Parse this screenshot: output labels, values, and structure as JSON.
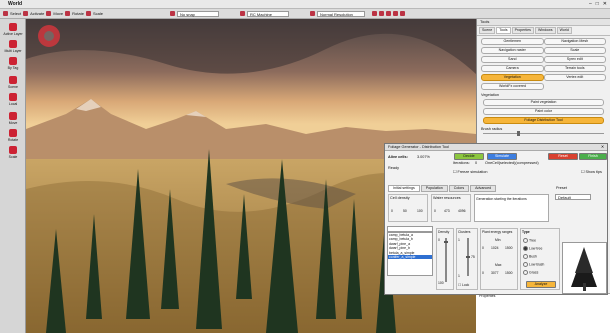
{
  "window": {
    "title": "World",
    "controls": [
      "–",
      "□",
      "✕"
    ]
  },
  "toolbar": {
    "items": [
      "Select",
      "Activate",
      "Move",
      "Rotate",
      "Scale"
    ],
    "dropdown1": "No snap",
    "dropdown2": "RC Machine",
    "dropdown3": "Normal Resolution",
    "icon_color": "#b33344"
  },
  "left_tools": [
    {
      "label": "Active Layer"
    },
    {
      "label": "Multi Layer"
    },
    {
      "label": "By Tag"
    },
    {
      "label": "Scene"
    },
    {
      "label": "Local"
    },
    {
      "label": "Move"
    },
    {
      "label": "Rotate"
    },
    {
      "label": "Scale"
    }
  ],
  "right_panel": {
    "header": "Tools",
    "tabs": [
      "Scene",
      "Tools",
      "Properties",
      "Windows",
      "World"
    ],
    "active_tab": "Tools",
    "buttons": [
      [
        "Gentlemen",
        "Navigation Mesh"
      ],
      [
        "Navigation raster",
        "Scale"
      ],
      [
        "Sand",
        "Syrex edit"
      ],
      [
        "Camera",
        "Terrain tools"
      ],
      [
        "Vegetation",
        "Vertex edit"
      ]
    ],
    "world_fx": "WorldFx covered",
    "vegetation_label": "Vegetation",
    "veg_buttons": [
      "Paint vegetation",
      "Paint color",
      "Foliage Distribution Tool"
    ],
    "brush_radius_label": "Brush radius",
    "properties_label": "Properties",
    "accent": "#f6b53a"
  },
  "dialog": {
    "title": "Foliage Generator - Distribution Tool",
    "alive_cells_label": "Alive cells:",
    "alive_cells_value": "3.007%",
    "ready_label": "Ready",
    "iterations_label": "Iterations:",
    "iterations_value": "0",
    "status_text": "OneCell(selected)(compressed)",
    "freeze_label": "Freeze simulation",
    "buttons": {
      "decide": "Decide",
      "simulate": "Simulate",
      "reset": "Reset",
      "finish": "Finish"
    },
    "button_colors": {
      "decide": "#8cc63f",
      "simulate": "#3d7ee0",
      "reset": "#d8402f",
      "finish": "#4cae4c"
    },
    "show_tips": "Show tips",
    "tabs": [
      "Initial settings",
      "Population",
      "Colors",
      "Advanced"
    ],
    "active_tab": "Initial settings",
    "preset_label": "Preset",
    "preset_value": "Default",
    "cell_density": {
      "label": "Cell density",
      "values": [
        "0",
        "50",
        "100"
      ]
    },
    "water_resources": {
      "label": "Water resources",
      "values": [
        "0",
        "473",
        "4096"
      ]
    },
    "tip_text": "Generation starting the iterations",
    "species": [
      "camp_betula_a",
      "camp_betula_b",
      "dwarf_pine_a",
      "dwarf_pine_b",
      "betula_a_simple",
      "conifer_a_simple"
    ],
    "selected_species": "conifer_a_simple",
    "density_label": "Density",
    "density_values": [
      "0",
      "100"
    ],
    "clusters_label": "Clusters",
    "clusters_values": [
      "1",
      "75",
      "1"
    ],
    "lock_label": "Lock",
    "plant_energy_label": "Plant energy ranges",
    "min_label": "Min",
    "max_label": "Max",
    "min_values": [
      "0",
      "1500",
      "1024"
    ],
    "max_values": [
      "0",
      "1500",
      "3077"
    ],
    "type_label": "Type",
    "types": [
      "Tree",
      "Low tree",
      "Bush",
      "Low Bush",
      "Grass"
    ],
    "selected_type": "Low tree",
    "analyze_label": "Analyze"
  }
}
